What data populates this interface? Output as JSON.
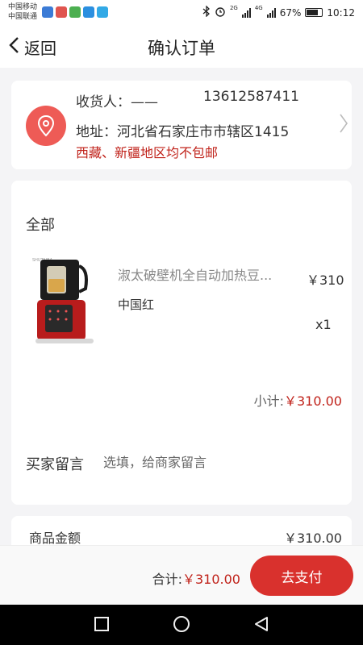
{
  "status_bar": {
    "carrier_1": "中国移动",
    "carrier_2": "中国联通",
    "network_1": "2G",
    "network_2": "4G",
    "battery": "67%",
    "time": "10:12"
  },
  "header": {
    "back_label": "返回",
    "title": "确认订单"
  },
  "address": {
    "receiver": "收货人：——",
    "phone": "13612587411",
    "address": "地址：河北省石家庄市市辖区1415",
    "notice": "西藏、新疆地区均不包邮"
  },
  "order": {
    "group_label": "全部",
    "product": {
      "name": "淑太破壁机全自动加热豆...",
      "price": "￥310",
      "variant": "中国红",
      "quantity": "x1"
    },
    "subtotal_label": "小计:",
    "subtotal_value": "￥310.00",
    "message_label": "买家留言",
    "message_placeholder": "选填，给商家留言"
  },
  "summary": {
    "goods_amount_label": "商品金额",
    "goods_amount_value": "￥310.00"
  },
  "footer": {
    "total_label": "合计:",
    "total_value": "￥310.00",
    "pay_label": "去支付"
  },
  "colors": {
    "accent": "#d9312d",
    "price_red": "#c0221a",
    "location_icon_bg": "#ee5b56"
  }
}
